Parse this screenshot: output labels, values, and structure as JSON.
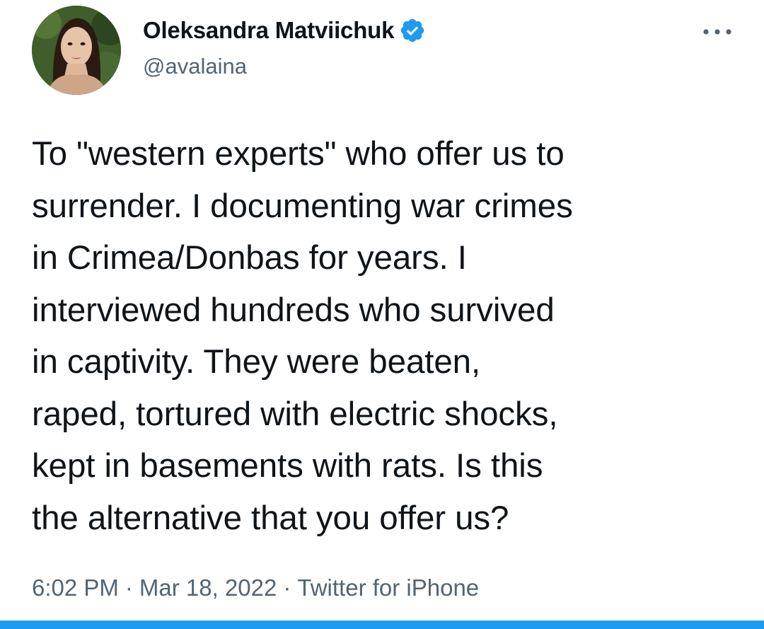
{
  "author": {
    "display_name": "Oleksandra Matviichuk",
    "handle": "@avalaina",
    "verified": true,
    "avatar_icon": "profile-photo"
  },
  "menu": {
    "icon": "more-horizontal-icon"
  },
  "tweet": {
    "text": "To \"western experts\" who offer us to\nsurrender. I documenting war crimes\nin Crimea/Donbas for years. I\ninterviewed hundreds who survived\nin captivity. They were beaten,\nraped, tortured with electric shocks,\nkept in basements with rats. Is this\nthe alternative that you offer us?"
  },
  "meta": {
    "time": "6:02 PM",
    "separator": "·",
    "date": "Mar 18, 2022",
    "source": "Twitter for iPhone"
  },
  "colors": {
    "accent": "#1d9bf0",
    "text_primary": "#0f1419",
    "text_secondary": "#536471",
    "background": "#ffffff"
  }
}
